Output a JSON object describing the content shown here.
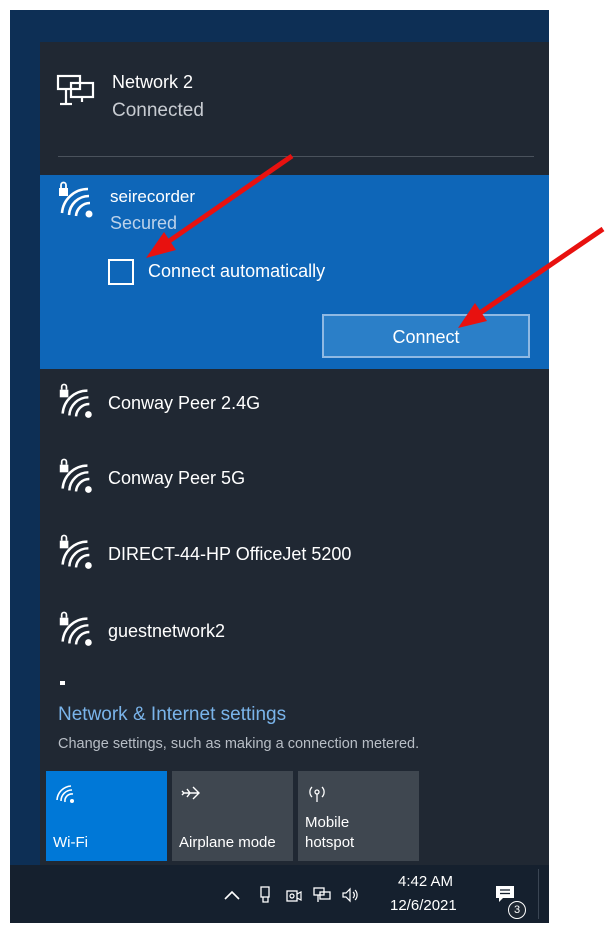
{
  "connected_network": {
    "name": "Network 2",
    "status": "Connected",
    "icon": "ethernet-icon"
  },
  "selected_network": {
    "name": "seirecorder",
    "status": "Secured",
    "connect_automatically_label": "Connect automatically",
    "connect_automatically_checked": false,
    "connect_button_label": "Connect",
    "icon": "wifi-secured-icon"
  },
  "networks": [
    {
      "name": "Conway Peer 2.4G",
      "icon": "wifi-secured-icon"
    },
    {
      "name": "Conway Peer 5G",
      "icon": "wifi-secured-icon"
    },
    {
      "name": "DIRECT-44-HP OfficeJet 5200",
      "icon": "wifi-secured-icon"
    },
    {
      "name": "guestnetwork2",
      "icon": "wifi-secured-icon"
    }
  ],
  "settings": {
    "link_label": "Network & Internet settings",
    "description": "Change settings, such as making a connection metered."
  },
  "quick_actions": [
    {
      "label": "Wi-Fi",
      "active": true,
      "icon": "wifi-icon"
    },
    {
      "label": "Airplane mode",
      "active": false,
      "icon": "airplane-icon"
    },
    {
      "label_line1": "Mobile",
      "label_line2": "hotspot",
      "active": false,
      "icon": "hotspot-icon"
    }
  ],
  "taskbar": {
    "time": "4:42 AM",
    "date": "12/6/2021",
    "notification_count": "3"
  },
  "colors": {
    "panel_bg": "#202833",
    "selected_bg": "#0e66b8",
    "accent": "#0078d7",
    "link": "#7ab4ea",
    "annotation_arrow": "#e8110f"
  }
}
